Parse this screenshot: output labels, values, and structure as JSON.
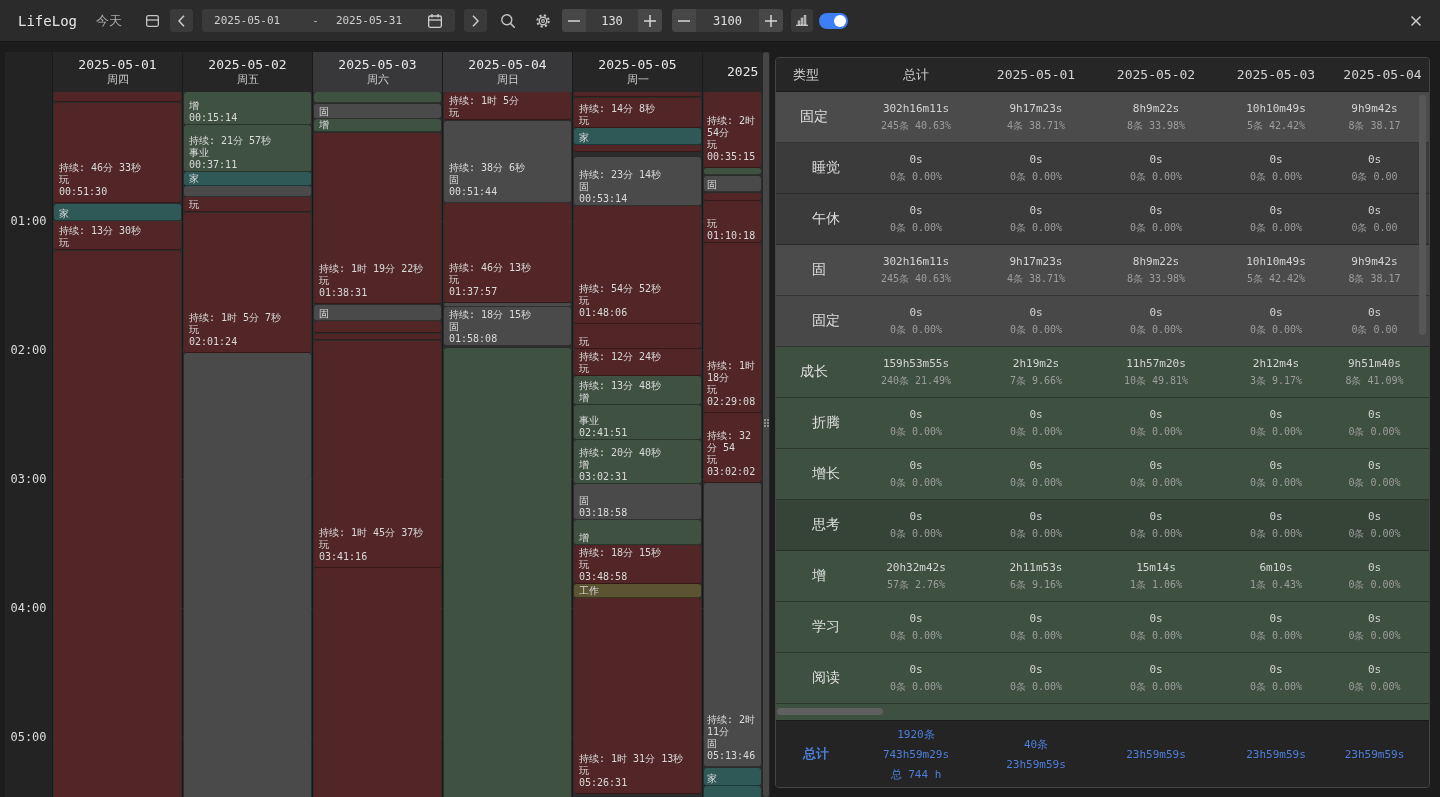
{
  "toolbar": {
    "title": "LifeLog",
    "today": "今天",
    "date_range": {
      "start": "2025-05-01",
      "separator": "-",
      "end": "2025-05-31"
    },
    "steppers": [
      {
        "value": "130"
      },
      {
        "value": "3100"
      }
    ],
    "chart_toggle": {
      "on": true
    }
  },
  "calendar": {
    "hours": [
      "01:00",
      "02:00",
      "03:00",
      "04:00",
      "05:00"
    ],
    "days": [
      {
        "date": "2025-05-01",
        "weekday": "周四",
        "weekend": false,
        "events": [
          {
            "color": "#522626"
          },
          {
            "color": "#522626",
            "lines": [
              "持续: 46分 33秒",
              "玩",
              "00:51:30"
            ]
          },
          {
            "color": "#2e5957",
            "lines": [
              "家"
            ]
          },
          {
            "color": "#522626",
            "lines": [
              "持续: 13分 30秒",
              "玩"
            ]
          },
          {
            "color": "#522626"
          }
        ]
      },
      {
        "date": "2025-05-02",
        "weekday": "周五",
        "weekend": false,
        "events": [
          {
            "color": "#3f5242",
            "lines": [
              "增",
              "00:15:14"
            ]
          },
          {
            "color": "#3f5242",
            "lines": [
              "持续: 21分 57秒",
              "事业",
              "00:37:11"
            ]
          },
          {
            "color": "#2e5957",
            "lines": [
              "家"
            ]
          },
          {
            "color": "#4a4a4a"
          },
          {
            "color": "#522626",
            "lines": [
              "玩"
            ]
          },
          {
            "color": "#522626",
            "lines": [
              "持续: 1时 5分 7秒",
              "玩",
              "02:01:24"
            ]
          },
          {
            "color": "#4a4a4a"
          }
        ]
      },
      {
        "date": "2025-05-03",
        "weekday": "周六",
        "weekend": true,
        "events": [
          {
            "color": "#3f5242"
          },
          {
            "color": "#4a4a4a",
            "lines": [
              "固"
            ]
          },
          {
            "color": "#3f5242",
            "lines": [
              "增"
            ]
          },
          {
            "color": "#522626",
            "lines": [
              "持续: 1时 19分 22秒",
              "玩",
              "01:38:31"
            ]
          },
          {
            "color": "#4a4a4a",
            "lines": [
              "固"
            ]
          },
          {
            "color": "#522626"
          },
          {
            "color": "#522626"
          },
          {
            "color": "#522626",
            "lines": [
              "持续: 1时 45分 37秒",
              "玩",
              "03:41:16"
            ]
          },
          {
            "color": "#522626"
          }
        ]
      },
      {
        "date": "2025-05-04",
        "weekday": "周日",
        "weekend": true,
        "events": [
          {
            "color": "#522626",
            "lines": [
              "持续: 1时 5分",
              "玩"
            ]
          },
          {
            "color": "#4a4a4a",
            "lines": [
              "持续: 38分 6秒",
              "固",
              "00:51:44"
            ]
          },
          {
            "color": "#522626",
            "lines": [
              "持续: 46分 13秒",
              "玩",
              "01:37:57"
            ]
          },
          {
            "color": "#4a4a4a"
          },
          {
            "color": "#4a4a4a",
            "lines": [
              "持续: 18分 15秒",
              "固",
              "01:58:08"
            ]
          },
          {
            "color": "#3f5242"
          }
        ]
      },
      {
        "date": "2025-05-05",
        "weekday": "周一",
        "weekend": false,
        "events": [
          {
            "color": "#522626"
          },
          {
            "color": "#522626",
            "lines": [
              "持续: 14分 8秒",
              "玩"
            ]
          },
          {
            "color": "#2e5957",
            "lines": [
              "家"
            ]
          },
          {
            "color": "#522626"
          },
          {
            "color": "#4a4a4a",
            "lines": [
              "持续: 23分 14秒",
              "固",
              "00:53:14"
            ]
          },
          {
            "color": "#522626",
            "lines": [
              "持续: 54分 52秒",
              "玩",
              "01:48:06"
            ]
          },
          {
            "color": "#522626",
            "lines": [
              "玩"
            ]
          },
          {
            "color": "#522626",
            "lines": [
              "持续: 12分 24秒",
              "玩"
            ]
          },
          {
            "color": "#3f5242",
            "lines": [
              "持续: 13分 48秒",
              "增"
            ]
          },
          {
            "color": "#3f5242",
            "lines": [
              "事业",
              "02:41:51"
            ]
          },
          {
            "color": "#3f5242",
            "lines": [
              "持续: 20分 40秒",
              "增",
              "03:02:31"
            ]
          },
          {
            "color": "#4a4a4a",
            "lines": [
              "固",
              "03:18:58"
            ]
          },
          {
            "color": "#3f5242",
            "lines": [
              "增"
            ]
          },
          {
            "color": "#522626",
            "lines": [
              "持续: 18分 15秒",
              "玩",
              "03:48:58"
            ]
          },
          {
            "color": "#5b5332",
            "lines": [
              "工作"
            ]
          },
          {
            "color": "#522626",
            "lines": [
              "持续: 1时 31分 13秒",
              "玩",
              "05:26:31"
            ]
          }
        ]
      },
      {
        "date": "2025",
        "weekend": false,
        "events": [
          {
            "color": "#522626",
            "lines": [
              "持续: 2时 54分",
              "玩",
              "00:35:15"
            ]
          },
          {
            "color": "#3f5242"
          },
          {
            "color": "#4a4a4a",
            "lines": [
              "固"
            ]
          },
          {
            "color": "#522626"
          },
          {
            "color": "#522626",
            "lines": [
              "玩",
              "01:10:18"
            ]
          },
          {
            "color": "#522626",
            "lines": [
              "持续: 1时 18分",
              "玩",
              "02:29:08"
            ]
          },
          {
            "color": "#522626",
            "lines": [
              "持续: 32分 54",
              "玩",
              "03:02:02"
            ]
          },
          {
            "color": "#4a4a4a",
            "lines": [
              "持续: 2时 11分",
              "固",
              "05:13:46"
            ]
          },
          {
            "color": "#2e5957",
            "lines": [
              "家"
            ]
          },
          {
            "color": "#2e5957"
          }
        ]
      }
    ]
  },
  "stats_table": {
    "label_header": "类型",
    "columns": [
      "总计",
      "2025-05-01",
      "2025-05-02",
      "2025-05-03",
      "2025-05-04"
    ],
    "rows": [
      {
        "label": "固定",
        "color": "#4b4b4b",
        "cells": [
          {
            "time": "302h16m11s",
            "share": "245条 40.63%"
          },
          {
            "time": "9h17m23s",
            "share": "4条 38.71%"
          },
          {
            "time": "8h9m22s",
            "share": "8条 33.98%"
          },
          {
            "time": "10h10m49s",
            "share": "5条 42.42%"
          },
          {
            "time": "9h9m42s",
            "share": "8条 38.17"
          }
        ],
        "children": [
          {
            "label": "睡觉",
            "color": "#3b3b3b",
            "cells": [
              {
                "time": "0s",
                "share": "0条 0.00%"
              },
              {
                "time": "0s",
                "share": "0条 0.00%"
              },
              {
                "time": "0s",
                "share": "0条 0.00%"
              },
              {
                "time": "0s",
                "share": "0条 0.00%"
              },
              {
                "time": "0s",
                "share": "0条 0.00"
              }
            ]
          },
          {
            "label": "午休",
            "color": "#3b3b3b",
            "cells": [
              {
                "time": "0s",
                "share": "0条 0.00%"
              },
              {
                "time": "0s",
                "share": "0条 0.00%"
              },
              {
                "time": "0s",
                "share": "0条 0.00%"
              },
              {
                "time": "0s",
                "share": "0条 0.00%"
              },
              {
                "time": "0s",
                "share": "0条 0.00"
              }
            ]
          },
          {
            "label": "固",
            "color": "#4b4b4b",
            "cells": [
              {
                "time": "302h16m11s",
                "share": "245条 40.63%"
              },
              {
                "time": "9h17m23s",
                "share": "4条 38.71%"
              },
              {
                "time": "8h9m22s",
                "share": "8条 33.98%"
              },
              {
                "time": "10h10m49s",
                "share": "5条 42.42%"
              },
              {
                "time": "9h9m42s",
                "share": "8条 38.17"
              }
            ]
          },
          {
            "label": "固定",
            "color": "#484848",
            "cells": [
              {
                "time": "0s",
                "share": "0条 0.00%"
              },
              {
                "time": "0s",
                "share": "0条 0.00%"
              },
              {
                "time": "0s",
                "share": "0条 0.00%"
              },
              {
                "time": "0s",
                "share": "0条 0.00%"
              },
              {
                "time": "0s",
                "share": "0条 0.00"
              }
            ]
          }
        ]
      },
      {
        "label": "成长",
        "color": "#3e5040",
        "cells": [
          {
            "time": "159h53m55s",
            "share": "240条 21.49%"
          },
          {
            "time": "2h19m2s",
            "share": "7条 9.66%"
          },
          {
            "time": "11h57m20s",
            "share": "10条 49.81%"
          },
          {
            "time": "2h12m4s",
            "share": "3条 9.17%"
          },
          {
            "time": "9h51m40s",
            "share": "8条 41.09%"
          }
        ],
        "children": [
          {
            "label": "折腾",
            "color": "#3e5040",
            "cells": [
              {
                "time": "0s",
                "share": "0条 0.00%"
              },
              {
                "time": "0s",
                "share": "0条 0.00%"
              },
              {
                "time": "0s",
                "share": "0条 0.00%"
              },
              {
                "time": "0s",
                "share": "0条 0.00%"
              },
              {
                "time": "0s",
                "share": "0条 0.00%"
              }
            ]
          },
          {
            "label": "增长",
            "color": "#3e5040",
            "cells": [
              {
                "time": "0s",
                "share": "0条 0.00%"
              },
              {
                "time": "0s",
                "share": "0条 0.00%"
              },
              {
                "time": "0s",
                "share": "0条 0.00%"
              },
              {
                "time": "0s",
                "share": "0条 0.00%"
              },
              {
                "time": "0s",
                "share": "0条 0.00%"
              }
            ]
          },
          {
            "label": "思考",
            "color": "#354437",
            "cells": [
              {
                "time": "0s",
                "share": "0条 0.00%"
              },
              {
                "time": "0s",
                "share": "0条 0.00%"
              },
              {
                "time": "0s",
                "share": "0条 0.00%"
              },
              {
                "time": "0s",
                "share": "0条 0.00%"
              },
              {
                "time": "0s",
                "share": "0条 0.00%"
              }
            ]
          },
          {
            "label": "增",
            "color": "#3e5040",
            "cells": [
              {
                "time": "20h32m42s",
                "share": "57条 2.76%"
              },
              {
                "time": "2h11m53s",
                "share": "6条 9.16%"
              },
              {
                "time": "15m14s",
                "share": "1条 1.06%"
              },
              {
                "time": "6m10s",
                "share": "1条 0.43%"
              },
              {
                "time": "0s",
                "share": "0条 0.00%"
              }
            ]
          },
          {
            "label": "学习",
            "color": "#3e5040",
            "cells": [
              {
                "time": "0s",
                "share": "0条 0.00%"
              },
              {
                "time": "0s",
                "share": "0条 0.00%"
              },
              {
                "time": "0s",
                "share": "0条 0.00%"
              },
              {
                "time": "0s",
                "share": "0条 0.00%"
              },
              {
                "time": "0s",
                "share": "0条 0.00%"
              }
            ]
          },
          {
            "label": "阅读",
            "color": "#3e5040",
            "cells": [
              {
                "time": "0s",
                "share": "0条 0.00%"
              },
              {
                "time": "0s",
                "share": "0条 0.00%"
              },
              {
                "time": "0s",
                "share": "0条 0.00%"
              },
              {
                "time": "0s",
                "share": "0条 0.00%"
              },
              {
                "time": "0s",
                "share": "0条 0.00%"
              }
            ]
          }
        ]
      }
    ],
    "total": {
      "label": "总计",
      "cells": [
        [
          "1920条",
          "743h59m29s",
          "总 744 h"
        ],
        [
          "40条",
          "23h59m59s"
        ],
        [
          "23h59m59s"
        ],
        [
          "23h59m59s"
        ],
        [
          "23h59m59s"
        ]
      ]
    }
  }
}
